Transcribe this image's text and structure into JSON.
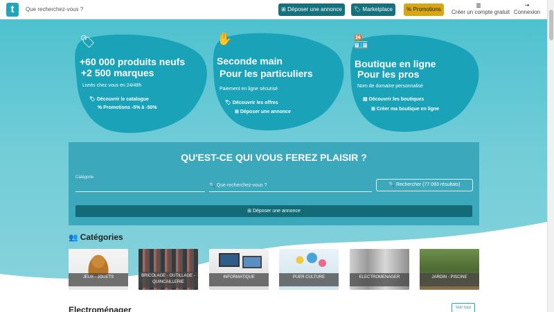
{
  "topbar": {
    "logo_letter": "t",
    "search_placeholder": "Que recherchez-vous ?",
    "deposer_label": "Déposer une annonce",
    "marketplace_label": "Marketplace",
    "promotions_label": "Promotions",
    "account_label": "Créer un compte gratuit",
    "login_label": "Connexion"
  },
  "hero": {
    "card1": {
      "title_line1": "+60 000 produits neufs",
      "title_line2": "+2 500 marques",
      "subtitle": "Livrés chez vous en 24/48h",
      "link1": "Découvrir le catalogue",
      "link2": "Promotions -5% à -50%"
    },
    "card2": {
      "title_line1": "Seconde main",
      "title_line2": "Pour les particuliers",
      "subtitle": "Paiement en ligne sécurisé",
      "link1": "Découvrir les offres",
      "link2": "Déposer une annonce"
    },
    "card3": {
      "title_line1": "Boutique en ligne",
      "title_line2": "Pour les pros",
      "subtitle": "Nom de domaine personnalisé",
      "link1": "Découvrir les boutiques",
      "link2": "Créer ma boutique en ligne"
    }
  },
  "search_panel": {
    "title": "QU'EST-CE QUI VOUS FEREZ PLAISIR ?",
    "category_label": "Catégorie",
    "query_placeholder": "Que recherchez-vous ?",
    "search_button": "Rechercher (77 093 résultats)",
    "deposer_button": "Déposer une annonce"
  },
  "categories": {
    "title": "Catégories",
    "items": [
      {
        "label": "JEUX - JOUETS"
      },
      {
        "label": "BRICOLAGE - OUTILLAGE - QUINCAILLERIE"
      },
      {
        "label": "INFORMATIQUE"
      },
      {
        "label": "PUER CULTURE"
      },
      {
        "label": "ELECTROMENAGER"
      },
      {
        "label": "JARDIN - PISCINE"
      }
    ]
  },
  "next_section": {
    "title": "Electroménager",
    "see_all": "Voir tout"
  },
  "colors": {
    "brand": "#1ea6bd",
    "dark_teal": "#15717e",
    "promo_yellow": "#d9a714"
  }
}
